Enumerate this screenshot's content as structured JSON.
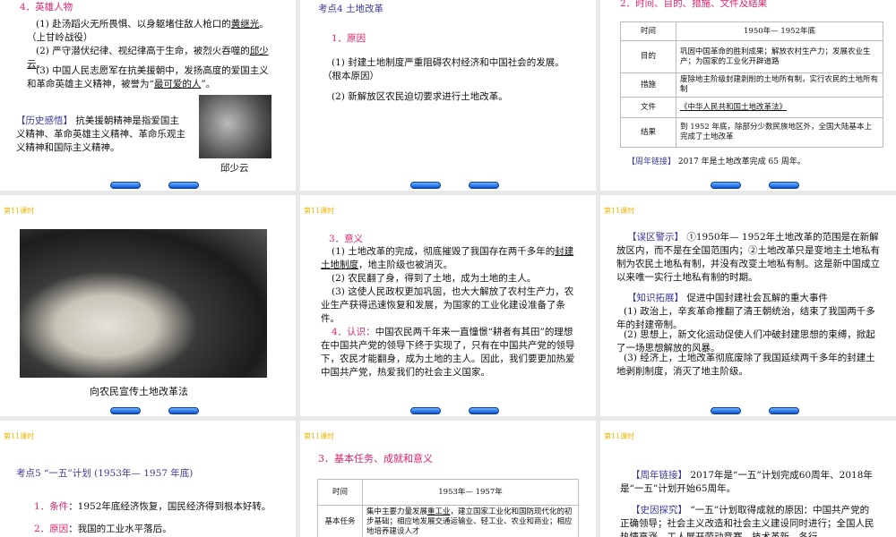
{
  "lesson_label": "第11课时",
  "s1": {
    "heading": "4．英雄人物",
    "p1a": "(1) 赴汤蹈火无所畏惧、以身躯堵住敌人枪口的",
    "p1u": "黄继光",
    "p1b": "。（上甘岭战役）",
    "p2a": "(2) 严守潜伏纪律、视纪律高于生命，被烈火吞噬的",
    "p2u": "邱少云",
    "p2b": "。",
    "p3a": "(3) 中国人民志愿军在抗美援朝中，发扬高度的爱国主义和革命英雄主义精神，被誉为“",
    "p3u": "最可爱的人",
    "p3b": "”。",
    "insight_label": "【历史感悟】",
    "insight_text": " 抗美援朝精神是指爱国主义精神、革命英雄主义精神、革命乐观主义精神和国际主义精神。",
    "caption": "邱少云"
  },
  "s2": {
    "title": "考点4  土地改革",
    "heading": "1．原因",
    "p1": "(1) 封建土地制度严重阻碍农村经济和中国社会的发展。（根本原因）",
    "p2": "(2) 新解放区农民迫切要求进行土地改革。"
  },
  "s3": {
    "heading": "2．时间、目的、措施、文件及结果",
    "rows": [
      {
        "k": "时间",
        "v": "1950年— 1952年底"
      },
      {
        "k": "目的",
        "v": "巩固中国革命的胜利成果；解放农村生产力；发展农业生产；为国家的工业化开辟道路"
      },
      {
        "k": "措施",
        "v": "废除地主阶级封建剥削的土地所有制，实行农民的土地所有制"
      },
      {
        "k": "文件",
        "v": "《中华人民共和国土地改革法》"
      },
      {
        "k": "结果",
        "v": "到 1952 年底，除部分少数民族地区外，全国大陆基本上完成了土地改革"
      }
    ],
    "link_label": "【周年链接】",
    "link_text": " 2017 年是土地改革完成 65 周年。"
  },
  "s4": {
    "caption": "向农民宣传土地改革法"
  },
  "s5": {
    "h3": "3．意义",
    "p1a": "(1) 土地改革的完成，彻底摧毁了我国存在两千多年的",
    "p1u": "封建土地制度",
    "p1b": "，地主阶级也被消灭。",
    "p2": "(2) 农民翻了身，得到了土地，成为土地的主人。",
    "p3": "(3) 这使人民政权更加巩固，也大大解放了农村生产力，农业生产获得迅速恢复和发展，为国家的工业化建设准备了条件。",
    "h4": "4．认识：",
    "p4": "中国农民两千年来一直憧憬“耕者有其田”的理想在中国共产党的领导下终于实现了，只有在中国共产党的领导下，农民才能翻身，成为土地的主人。因此，我们要更加热爱中国共产党，热爱我们的社会主义国家。"
  },
  "s6": {
    "warn_label": "【误区警示】",
    "warn_text": " ①1950年— 1952年土地改革的范围是在新解放区内，而不是在全国范围内；②土地改革只是变地主土地私有制为农民土地私有制，并没有改变土地私有制。这是新中国成立以来唯一实行土地私有制的时期。",
    "ext_label": "【知识拓展】",
    "ext_text": " 促进中国封建社会瓦解的重大事件",
    "e1": "(1) 政治上，辛亥革命推翻了清王朝统治，结束了我国两千多年的封建帝制。",
    "e2": "(2) 思想上，新文化运动促使人们冲破封建思想的束缚，掀起了一场思想解放的风暴。",
    "e3": "(3) 经济上，土地改革彻底废除了我国延续两千多年的封建土地剥削制度，消灭了地主阶级。"
  },
  "s7": {
    "title": "考点5 “一五”计划 (1953年— 1957 年底)",
    "c_label": "1．条件",
    "c_text": "：1952年底经济恢复，国民经济得到根本好转。",
    "r_label": "2．原因",
    "r_text": "：我国的工业水平落后。"
  },
  "s8": {
    "heading": "3．基本任务、成就和意义",
    "r1k": "时间",
    "r1v": "1953年— 1957年",
    "r2k": "基本任务",
    "r2a": "集中主要力量发展",
    "r2u": "重工业",
    "r2b": "，建立国家工业化和国防现代化的初步基础；相应地发展交通运输业、轻工业、农业和商业；相应地培养建设人才"
  },
  "s9": {
    "link_label": "【周年链接】",
    "link_text": " 2017年是“一五”计划完成60周年、2018年是“一五”计划开始65周年。",
    "why_label": "【史因探究】",
    "why_text": " “一五”计划取得成就的原因：中国共产党的正确领导；社会主义改造和社会主义建设同时进行；全国人民热情高涨，工人展开劳动竞赛、技术革新，各行"
  }
}
